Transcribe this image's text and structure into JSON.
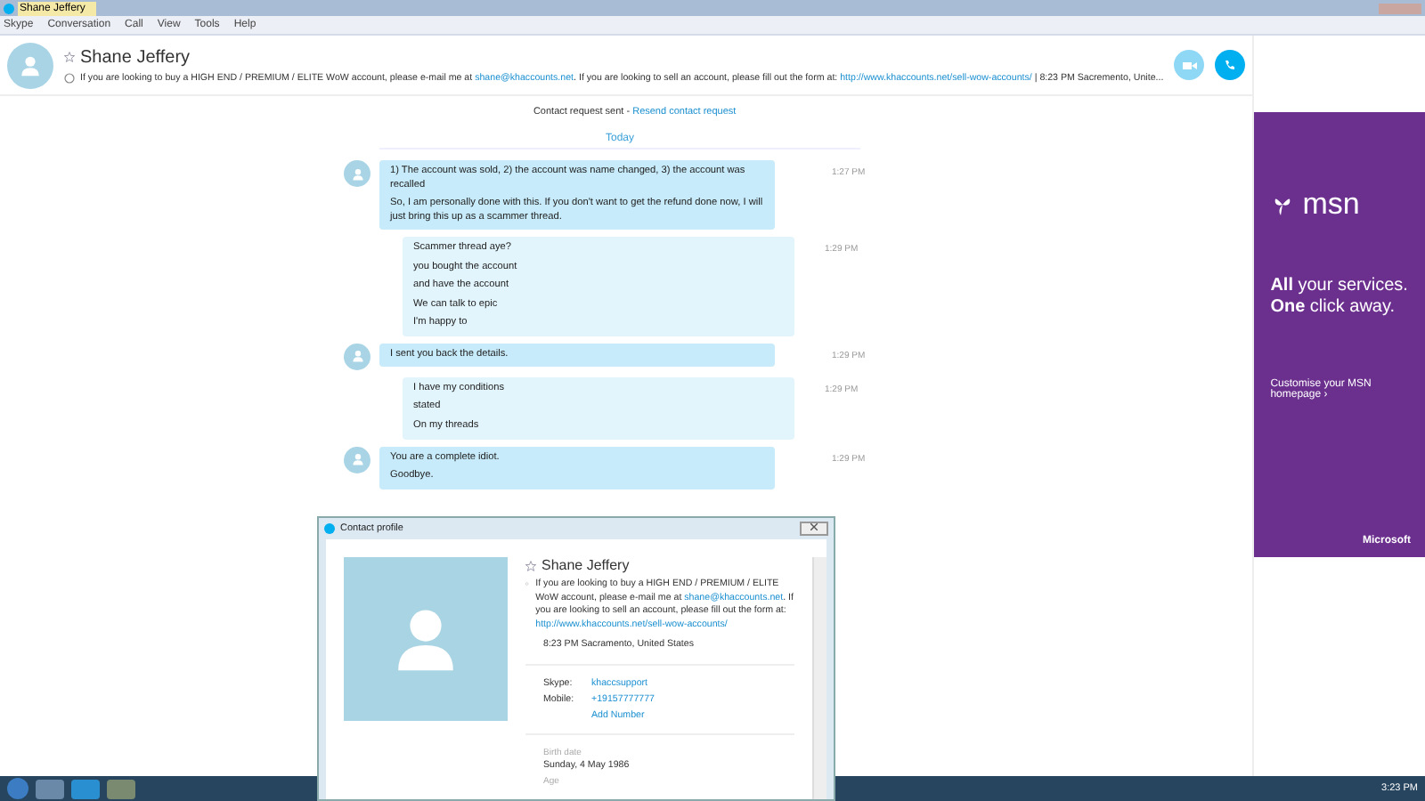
{
  "window": {
    "title": "Shane Jeffery"
  },
  "menu": [
    "Skype",
    "Conversation",
    "Call",
    "View",
    "Tools",
    "Help"
  ],
  "header": {
    "name": "Shane Jeffery",
    "mood": "If you are looking to buy a HIGH END / PREMIUM / ELITE WoW account, please e-mail me at ",
    "email": "shane@khaccounts.net",
    "mood_mid": ". If you are looking to sell an account, please fill out the form at: ",
    "url": "http://www.khaccounts.net/sell-wow-accounts/",
    "mood_end": " | 8:23 PM Sacremento, Unite..."
  },
  "contact_request": {
    "text": "Contact request sent - ",
    "link": "Resend contact request"
  },
  "day_label": "Today",
  "messages": [
    {
      "kind": "incoming",
      "lines": [
        "1) The account was sold, 2) the account was name changed, 3) the account was recalled",
        "So, I am personally done with this.  If you don't want to get the refund done now, I will just bring this up as a scammer thread."
      ],
      "time": "1:27 PM"
    },
    {
      "kind": "outgoing",
      "lines": [
        "Scammer thread aye?",
        "you bought the account",
        "and have the account",
        "We can talk to epic",
        "I'm happy to"
      ],
      "time": "1:29 PM"
    },
    {
      "kind": "incoming",
      "lines": [
        "I sent you back the details."
      ],
      "time": "1:29 PM"
    },
    {
      "kind": "outgoing",
      "lines": [
        "I have my conditions",
        "stated",
        "On my threads"
      ],
      "time": "1:29 PM"
    },
    {
      "kind": "incoming",
      "lines": [
        "You are a complete idiot.",
        "Goodbye."
      ],
      "time": "1:29 PM"
    }
  ],
  "ad": {
    "brand": "msn",
    "headline_1": "**All** your services.",
    "headline_2": "**One** click away.",
    "cta": "Customise your MSN homepage ›",
    "footer": "Microsoft"
  },
  "profile": {
    "title": "Contact profile",
    "name": "Shane Jeffery",
    "mood": "If you are looking to buy a HIGH END / PREMIUM / ELITE WoW account, please e-mail me at ",
    "email": "shane@khaccounts.net",
    "mood_mid": ".  If you are looking to sell an account, please fill out the form at: ",
    "url": "http://www.khaccounts.net/sell-wow-accounts/",
    "location": "8:23 PM Sacramento, United States",
    "fields": [
      {
        "label": "Skype:",
        "value": "khaccsupport"
      },
      {
        "label": "Mobile:",
        "value": "+19157777777"
      },
      {
        "value": "Add Number"
      }
    ],
    "birth_label": "Birth date",
    "birth": "Sunday, 4 May 1986",
    "age_label": "Age"
  },
  "taskbar": {
    "clock": "3:23 PM"
  }
}
